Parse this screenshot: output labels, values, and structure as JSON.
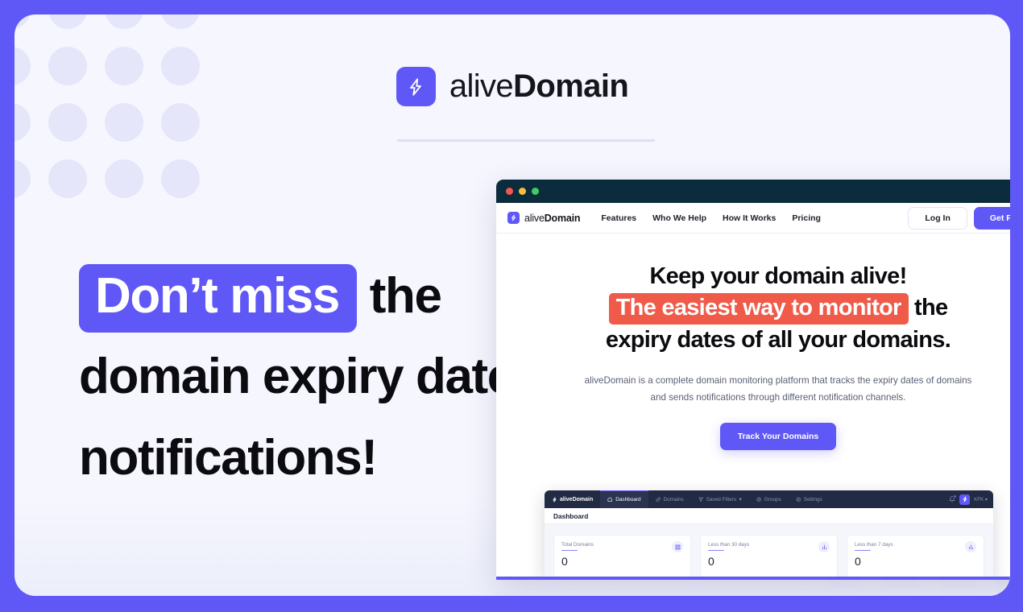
{
  "theme": {
    "frame_color": "#6058f6",
    "card_bg": "#f5f6fe",
    "accent": "#6058f6",
    "highlight_red": "#ef5a49",
    "dot_color": "#e6e6fb",
    "titlebar": "#0b2c3d",
    "app_nav": "#222b44"
  },
  "brand": {
    "light": "alive",
    "bold": "Domain",
    "icon": "lightning-bolt-icon"
  },
  "headline": {
    "highlight": "Don’t miss",
    "rest_line1": " the",
    "line2": "domain expiry date",
    "line3": "notifications!"
  },
  "browser": {
    "traffic_lights": [
      "close-red",
      "minimize-yellow",
      "maximize-green"
    ],
    "nav": {
      "brand_light": "alive",
      "brand_bold": "Domain",
      "links": [
        "Features",
        "Who We Help",
        "How It Works",
        "Pricing"
      ],
      "login_label": "Log In",
      "trial_label": "Get Free Trial"
    },
    "hero": {
      "line1": "Keep your domain alive!",
      "highlight": "The easiest way to monitor",
      "line2_rest": " the",
      "line3": "expiry dates of all your domains.",
      "subtitle": "aliveDomain is a complete domain monitoring platform that tracks the expiry dates of domains and sends notifications through different notification channels.",
      "cta_label": "Track Your Domains"
    },
    "app": {
      "brand": "aliveDomain",
      "menu": [
        {
          "label": "Dashboard",
          "icon": "home-icon",
          "active": true
        },
        {
          "label": "Domains",
          "icon": "link-icon",
          "active": false
        },
        {
          "label": "Saved Filters",
          "icon": "filter-icon",
          "active": false,
          "caret": "▾"
        },
        {
          "label": "Groups",
          "icon": "group-icon",
          "active": false
        },
        {
          "label": "Settings",
          "icon": "gear-icon",
          "active": false
        }
      ],
      "notifications_icon": "bell-icon",
      "user_initials": "KFK",
      "user_caret": "▾",
      "page_title": "Dashboard",
      "stats": [
        {
          "label": "Total Domains",
          "value": "0",
          "icon": "grid-icon"
        },
        {
          "label": "Less than 30 days",
          "value": "0",
          "icon": "bar-chart-icon"
        },
        {
          "label": "Less than 7 days",
          "value": "0",
          "icon": "bar-chart-icon"
        }
      ]
    }
  }
}
